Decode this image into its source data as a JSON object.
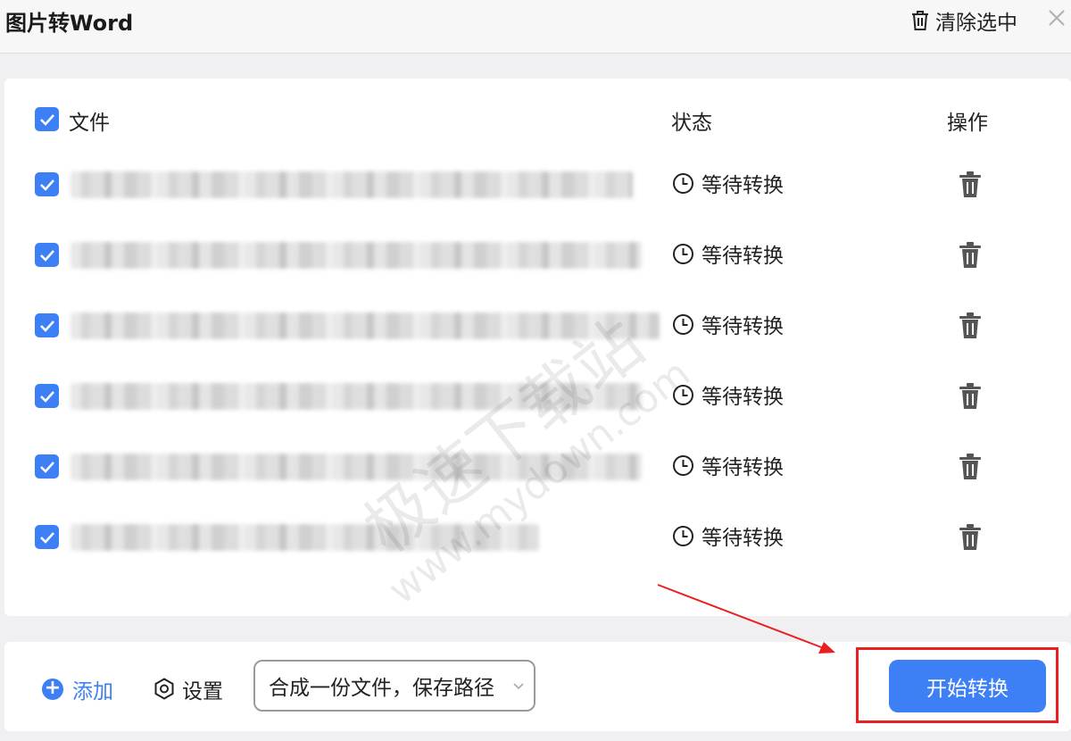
{
  "window": {
    "title": "图片转Word",
    "clear_selected_label": "清除选中"
  },
  "table": {
    "header": {
      "file_label": "文件",
      "status_label": "状态",
      "action_label": "操作"
    },
    "rows": [
      {
        "status": "等待转换",
        "checked": true
      },
      {
        "status": "等待转换",
        "checked": true
      },
      {
        "status": "等待转换",
        "checked": true
      },
      {
        "status": "等待转换",
        "checked": true
      },
      {
        "status": "等待转换",
        "checked": true
      },
      {
        "status": "等待转换",
        "checked": true
      }
    ]
  },
  "watermark": {
    "text": "极速下载站",
    "url": "www.mydown.com"
  },
  "footer": {
    "add_label": "添加",
    "settings_label": "设置",
    "output_mode": "合成一份文件，保存路径",
    "start_label": "开始转换"
  },
  "colors": {
    "accent": "#3d7ff5",
    "highlight": "#e8201f"
  }
}
